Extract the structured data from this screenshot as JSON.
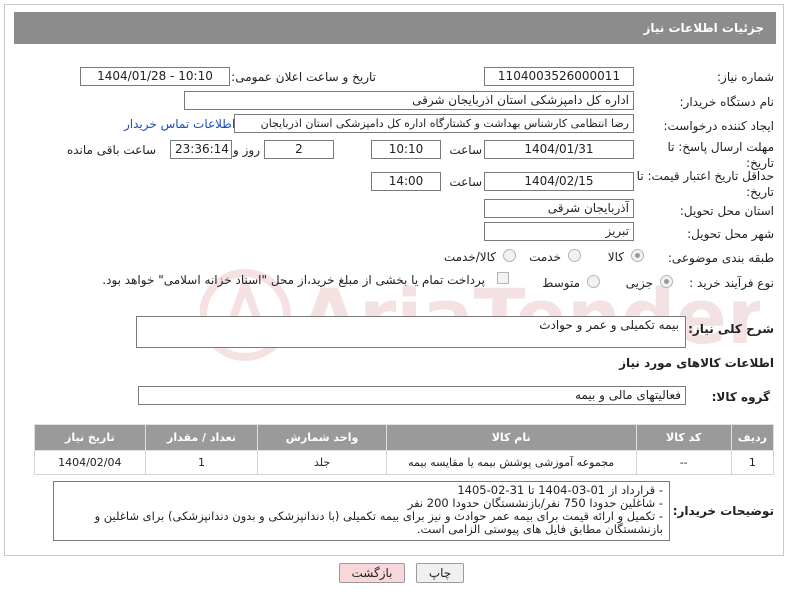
{
  "header": {
    "title": "جزئیات اطلاعات نیاز"
  },
  "form": {
    "need_number_label": "شماره نیاز:",
    "need_number": "1104003526000011",
    "announce_label": "تاریخ و ساعت اعلان عمومی:",
    "announce_value": "1404/01/28 - 10:10",
    "buyer_org_label": "نام دستگاه خریدار:",
    "buyer_org": "اداره کل دامپزشکی استان اذربایجان شرقی",
    "creator_label": "ایجاد کننده درخواست:",
    "creator": "رضا انتظامی کارشناس بهداشت و کشتارگاه اداره کل دامپزشکی استان اذربایجان",
    "contact_link": "اطلاعات تماس خریدار",
    "reply_deadline_label": "مهلت ارسال پاسخ: تا تاریخ:",
    "reply_date": "1404/01/31",
    "time_label": "ساعت",
    "reply_time": "10:10",
    "days_value": "2",
    "days_label": "روز و",
    "remaining_time": "23:36:14",
    "remaining_label": "ساعت باقی مانده",
    "price_validity_label": "حداقل تاریخ اعتبار قیمت: تا تاریخ:",
    "price_date": "1404/02/15",
    "price_time": "14:00",
    "province_label": "استان محل تحویل:",
    "province": "آذربایجان شرقی",
    "city_label": "شهر محل تحویل:",
    "city": "تبریز",
    "category_label": "طبقه بندی موضوعی:",
    "category_options": [
      "کالا",
      "خدمت",
      "کالا/خدمت"
    ],
    "process_label": "نوع فرآیند خرید :",
    "process_options": [
      "جزیی",
      "متوسط"
    ],
    "payment_note": "پرداخت تمام یا بخشی از مبلغ خرید،از محل \"اسناد خزانه اسلامی\" خواهد بود."
  },
  "description": {
    "label": "شرح کلی نیاز:",
    "value": "بیمه تکمیلی و عمر و حوادث"
  },
  "goods": {
    "section_title": "اطلاعات کالاهای مورد نیاز",
    "group_label": "گروه کالا:",
    "group_value": "فعالیتهای مالی و بیمه",
    "columns": [
      "ردیف",
      "کد کالا",
      "نام کالا",
      "واحد شمارش",
      "تعداد / مقدار",
      "تاریخ نیاز"
    ],
    "rows": [
      [
        "1",
        "--",
        "مجموعه آموزشی پوشش بیمه یا مقایسه بیمه",
        "جلد",
        "1",
        "1404/02/04"
      ]
    ]
  },
  "buyer_notes": {
    "label": "توضیحات خریدار:",
    "lines": [
      "- قرارداد از 01-03-1404 تا 31-02-1405",
      "- شاغلین حدودا 750 نفر/بازنشستگان حدودا 200 نفر",
      "- تکمیل و ارائه قیمت برای بیمه عمر حوادث و نیز برای بیمه تکمیلی (با دندانپزشکی و بدون دندانپزشکی) برای شاغلین و",
      "بازنشستگان مطابق فایل های پیوستی الزامی است."
    ]
  },
  "buttons": {
    "print": "چاپ",
    "back": "بازگشت"
  },
  "watermark_text": "AriaTender.neT",
  "colors": {
    "header": "#8c8c8c",
    "link": "#1a4fb3",
    "back_button": "#f7d7da",
    "print_button": "#f0f0f0"
  }
}
